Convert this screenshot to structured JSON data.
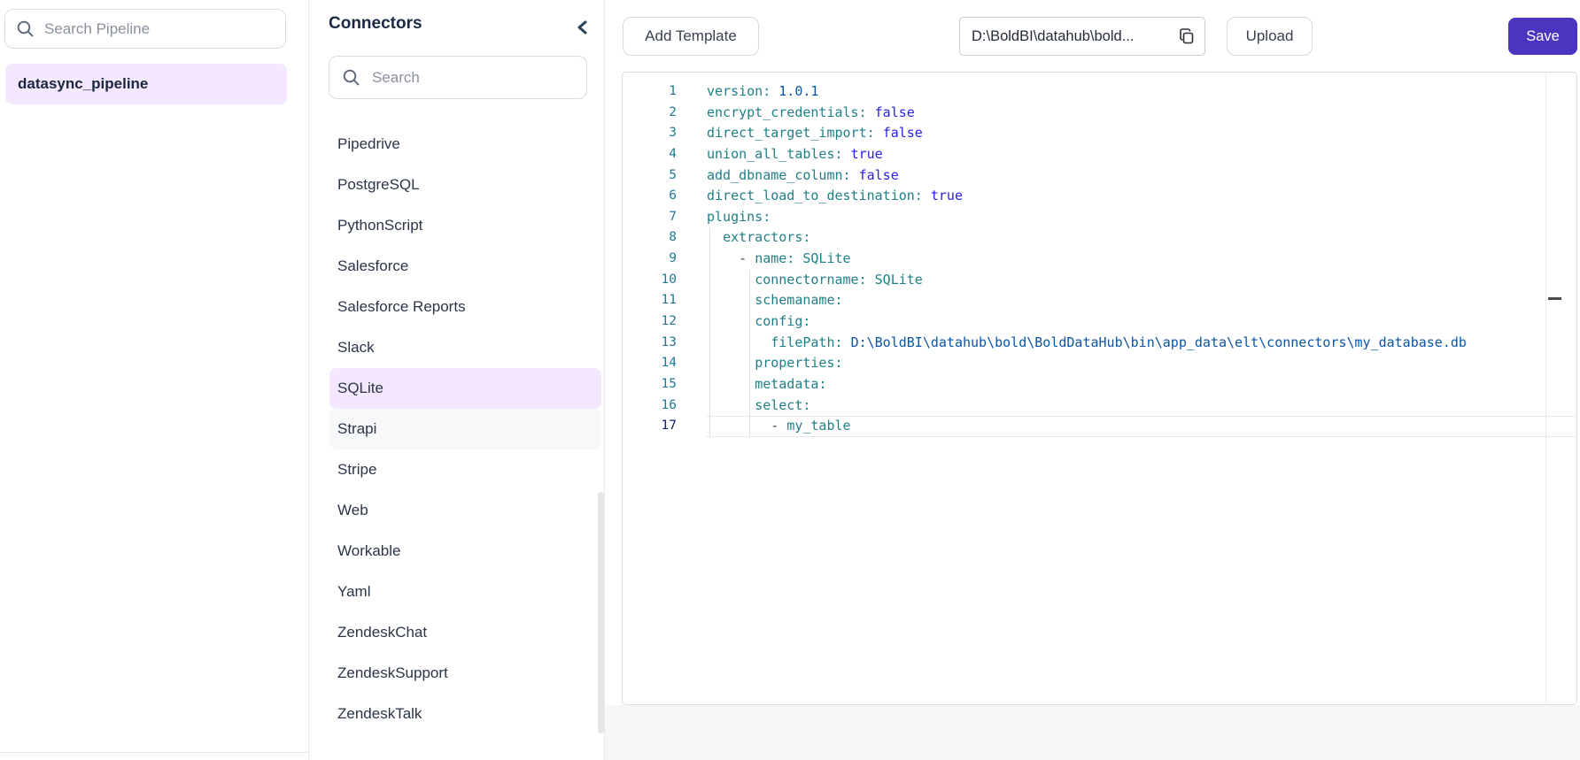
{
  "colors": {
    "accent": "#4a35c1",
    "selected_bg": "#f3e8fd",
    "hover_bg": "#f7f8fa",
    "key": "#1f7f87",
    "value": "#1f7f87",
    "bool": "#2a21e6",
    "num": "#0a55a6",
    "punct": "#3b4248",
    "line_number": "#237893",
    "active_line_number": "#0b216f"
  },
  "pipelines_panel": {
    "search_placeholder": "Search Pipeline",
    "items": [
      {
        "label": "datasync_pipeline",
        "selected": true
      }
    ]
  },
  "connectors_panel": {
    "title": "Connectors",
    "search_placeholder": "Search",
    "items": [
      "Pipedrive",
      "PostgreSQL",
      "PythonScript",
      "Salesforce",
      "Salesforce Reports",
      "Slack",
      "SQLite",
      "Strapi",
      "Stripe",
      "Web",
      "Workable",
      "Yaml",
      "ZendeskChat",
      "ZendeskSupport",
      "ZendeskTalk"
    ],
    "selected_item": "SQLite",
    "hovered_item": "Strapi"
  },
  "toolbar": {
    "add_template_label": "Add Template",
    "path_value": "D:\\BoldBI\\datahub\\bold...",
    "upload_label": "Upload",
    "save_label": "Save"
  },
  "editor": {
    "language": "yaml",
    "active_line": 17,
    "lines": [
      {
        "n": 1,
        "guides": [],
        "tokens": [
          [
            "version:",
            "key"
          ],
          [
            " ",
            ""
          ],
          [
            "1.0.1",
            "num"
          ]
        ]
      },
      {
        "n": 2,
        "guides": [],
        "tokens": [
          [
            "encrypt_credentials:",
            "key"
          ],
          [
            " ",
            ""
          ],
          [
            "false",
            "bool"
          ]
        ]
      },
      {
        "n": 3,
        "guides": [],
        "tokens": [
          [
            "direct_target_import:",
            "key"
          ],
          [
            " ",
            ""
          ],
          [
            "false",
            "bool"
          ]
        ]
      },
      {
        "n": 4,
        "guides": [],
        "tokens": [
          [
            "union_all_tables:",
            "key"
          ],
          [
            " ",
            ""
          ],
          [
            "true",
            "bool"
          ]
        ]
      },
      {
        "n": 5,
        "guides": [],
        "tokens": [
          [
            "add_dbname_column:",
            "key"
          ],
          [
            " ",
            ""
          ],
          [
            "false",
            "bool"
          ]
        ]
      },
      {
        "n": 6,
        "guides": [],
        "tokens": [
          [
            "direct_load_to_destination:",
            "key"
          ],
          [
            " ",
            ""
          ],
          [
            "true",
            "bool"
          ]
        ]
      },
      {
        "n": 7,
        "guides": [],
        "tokens": [
          [
            "plugins:",
            "key"
          ]
        ]
      },
      {
        "n": 8,
        "guides": [
          0
        ],
        "tokens": [
          [
            "  ",
            ""
          ],
          [
            "extractors:",
            "key"
          ]
        ]
      },
      {
        "n": 9,
        "guides": [
          0
        ],
        "tokens": [
          [
            "    ",
            ""
          ],
          [
            "- ",
            "punct"
          ],
          [
            "name:",
            "key"
          ],
          [
            " ",
            ""
          ],
          [
            "SQLite",
            "val"
          ]
        ]
      },
      {
        "n": 10,
        "guides": [
          0,
          5
        ],
        "tokens": [
          [
            "      ",
            ""
          ],
          [
            "connectorname:",
            "key"
          ],
          [
            " ",
            ""
          ],
          [
            "SQLite",
            "val"
          ]
        ]
      },
      {
        "n": 11,
        "guides": [
          0,
          5
        ],
        "tokens": [
          [
            "      ",
            ""
          ],
          [
            "schemaname:",
            "key"
          ]
        ]
      },
      {
        "n": 12,
        "guides": [
          0,
          5
        ],
        "tokens": [
          [
            "      ",
            ""
          ],
          [
            "config:",
            "key"
          ]
        ]
      },
      {
        "n": 13,
        "guides": [
          0,
          5
        ],
        "tokens": [
          [
            "        ",
            ""
          ],
          [
            "filePath:",
            "key"
          ],
          [
            " ",
            ""
          ],
          [
            "D:\\BoldBI\\datahub\\bold\\BoldDataHub\\bin\\app_data\\elt\\connectors\\my_database.db",
            "num"
          ]
        ]
      },
      {
        "n": 14,
        "guides": [
          0,
          5
        ],
        "tokens": [
          [
            "      ",
            ""
          ],
          [
            "properties:",
            "key"
          ]
        ]
      },
      {
        "n": 15,
        "guides": [
          0,
          5
        ],
        "tokens": [
          [
            "      ",
            ""
          ],
          [
            "metadata:",
            "key"
          ]
        ]
      },
      {
        "n": 16,
        "guides": [
          0,
          5
        ],
        "tokens": [
          [
            "      ",
            ""
          ],
          [
            "select:",
            "key"
          ]
        ]
      },
      {
        "n": 17,
        "guides": [
          0,
          5
        ],
        "tokens": [
          [
            "        ",
            ""
          ],
          [
            "- ",
            "punct"
          ],
          [
            "my_table",
            "val"
          ]
        ]
      }
    ]
  }
}
